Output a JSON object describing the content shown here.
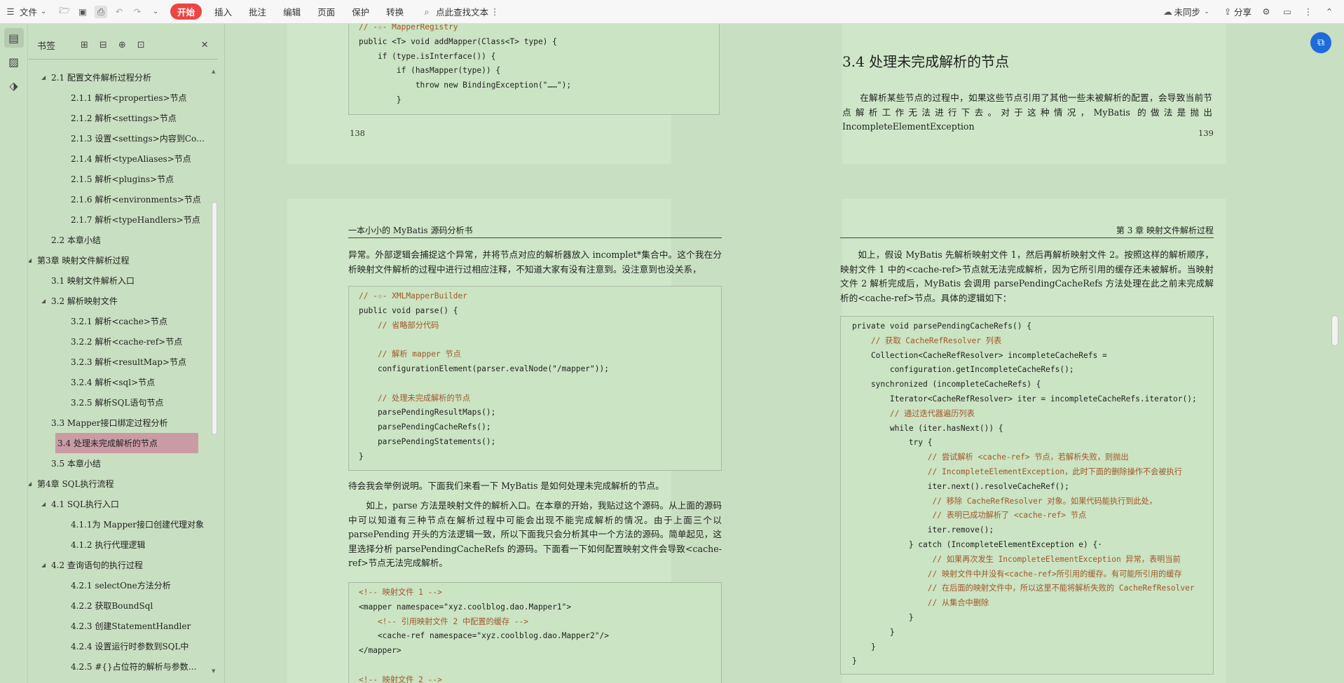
{
  "toolbar": {
    "menu_label": "文件",
    "tabs": [
      "开始",
      "插入",
      "批注",
      "编辑",
      "页面",
      "保护",
      "转换"
    ],
    "search_placeholder": "点此查找文本",
    "sync_label": "未同步",
    "share_label": "分享"
  },
  "panel": {
    "title": "书签",
    "items": [
      {
        "label": "2.1 配置文件解析过程分析",
        "level": 2,
        "expanded": true
      },
      {
        "label": "2.1.1 解析<properties>节点",
        "level": 3
      },
      {
        "label": "2.1.2 解析<settings>节点",
        "level": 3
      },
      {
        "label": "2.1.3 设置<settings>内容到Co…",
        "level": 3
      },
      {
        "label": "2.1.4 解析<typeAliases>节点",
        "level": 3
      },
      {
        "label": "2.1.5 解析<plugins>节点",
        "level": 3
      },
      {
        "label": "2.1.6 解析<environments>节点",
        "level": 3
      },
      {
        "label": "2.1.7 解析<typeHandlers>节点",
        "level": 3
      },
      {
        "label": "2.2 本章小结",
        "level": 2
      },
      {
        "label": "第3章 映射文件解析过程",
        "level": 1,
        "expanded": true
      },
      {
        "label": "3.1 映射文件解析入口",
        "level": 2
      },
      {
        "label": "3.2 解析映射文件",
        "level": 2,
        "expanded": true
      },
      {
        "label": "3.2.1 解析<cache>节点",
        "level": 3
      },
      {
        "label": "3.2.2 解析<cache-ref>节点",
        "level": 3
      },
      {
        "label": "3.2.3 解析<resultMap>节点",
        "level": 3
      },
      {
        "label": "3.2.4 解析<sql>节点",
        "level": 3
      },
      {
        "label": "3.2.5 解析SQL语句节点",
        "level": 3
      },
      {
        "label": "3.3 Mapper接口绑定过程分析",
        "level": 2
      },
      {
        "label": "3.4 处理未完成解析的节点",
        "level": 2,
        "selected": true
      },
      {
        "label": "3.5 本章小结",
        "level": 2
      },
      {
        "label": "第4章 SQL执行流程",
        "level": 1,
        "expanded": true
      },
      {
        "label": "4.1 SQL执行入口",
        "level": 2,
        "expanded": true
      },
      {
        "label": "4.1.1为 Mapper接口创建代理对象",
        "level": 3
      },
      {
        "label": "4.1.2 执行代理逻辑",
        "level": 3
      },
      {
        "label": "4.2 查询语句的执行过程",
        "level": 2,
        "expanded": true
      },
      {
        "label": "4.2.1 selectOne方法分析",
        "level": 3
      },
      {
        "label": "4.2.2 获取BoundSql",
        "level": 3
      },
      {
        "label": "4.2.3 创建StatementHandler",
        "level": 3
      },
      {
        "label": "4.2.4 设置运行时参数到SQL中",
        "level": 3
      },
      {
        "label": "4.2.5 #{}占位符的解析与参数…",
        "level": 3
      }
    ]
  },
  "page138": {
    "code": [
      "// -☆- MapperRegistry",
      "public <T> void addMapper(Class<T> type) {",
      "    if (type.isInterface()) {",
      "        if (hasMapper(type)) {",
      "            throw new BindingException(\"……\");",
      "        }"
    ],
    "page_number": "138"
  },
  "page139": {
    "heading": "3.4 处理未完成解析的节点",
    "paragraph": "在解析某些节点的过程中，如果这些节点引用了其他一些未被解析的配置，会导致当前节点解析工作无法进行下去。对于这种情况，MyBatis 的做法是抛出 IncompleteElementException",
    "page_number": "139"
  },
  "page140": {
    "header": "一本小小的 MyBatis 源码分析书",
    "para1": "异常。外部逻辑会捕捉这个异常，并将节点对应的解析器放入 incomplet*集合中。这个我在分析映射文件解析的过程中进行过相应注释，不知道大家有没有注意到。没注意到也没关系，",
    "code1": [
      "// -☆- XMLMapperBuilder",
      "public void parse() {",
      "    // 省略部分代码",
      "",
      "    // 解析 mapper 节点",
      "    configurationElement(parser.evalNode(\"/mapper\"));",
      "",
      "    // 处理未完成解析的节点",
      "    parsePendingResultMaps();",
      "    parsePendingCacheRefs();",
      "    parsePendingStatements();",
      "}"
    ],
    "para2": "待会我会举例说明。下面我们来看一下 MyBatis 是如何处理未完成解析的节点。",
    "para3": "如上，parse 方法是映射文件的解析入口。在本章的开始，我贴过这个源码。从上面的源码中可以知道有三种节点在解析过程中可能会出现不能完成解析的情况。由于上面三个以 parsePending 开头的方法逻辑一致，所以下面我只会分析其中一个方法的源码。简单起见，这里选择分析 parsePendingCacheRefs 的源码。下面看一下如何配置映射文件会导致<cache-ref>节点无法完成解析。",
    "code2": [
      "<!-- 映射文件 1 -->",
      "<mapper namespace=\"xyz.coolblog.dao.Mapper1\">",
      "    <!-- 引用映射文件 2 中配置的缓存 -->",
      "    <cache-ref namespace=\"xyz.coolblog.dao.Mapper2\"/>",
      "</mapper>",
      "",
      "<!-- 映射文件 2 -->"
    ]
  },
  "page141": {
    "header": "第 3 章 映射文件解析过程",
    "para1": "如上，假设 MyBatis 先解析映射文件 1，然后再解析映射文件 2。按照这样的解析顺序，映射文件 1 中的<cache-ref>节点就无法完成解析，因为它所引用的缓存还未被解析。当映射文件 2 解析完成后，MyBatis 会调用 parsePendingCacheRefs 方法处理在此之前未完成解析的<cache-ref>节点。具体的逻辑如下：",
    "code": [
      "private void parsePendingCacheRefs() {",
      "    // 获取 CacheRefResolver 列表",
      "    Collection<CacheRefResolver> incompleteCacheRefs =",
      "        configuration.getIncompleteCacheRefs();",
      "    synchronized (incompleteCacheRefs) {",
      "        Iterator<CacheRefResolver> iter = incompleteCacheRefs.iterator();",
      "        // 通过迭代器遍历列表",
      "        while (iter.hasNext()) {",
      "            try {",
      "                // 尝试解析 <cache-ref> 节点，若解析失败，则抛出",
      "                // IncompleteElementException，此时下面的删除操作不会被执行",
      "                iter.next().resolveCacheRef();",
      "                 // 移除 CacheRefResolver 对象。如果代码能执行到此处，",
      "                 // 表明已成功解析了 <cache-ref> 节点",
      "                iter.remove();",
      "            } catch (IncompleteElementException e) {·",
      "                 // 如果再次发生 IncompleteElementException 异常，表明当前",
      "                // 映射文件中并没有<cache-ref>所引用的缓存。有可能所引用的缓存",
      "                // 在后面的映射文件中，所以这里不能将解析失败的 CacheRefResolver",
      "                // 从集合中删除",
      "            }",
      "        }",
      "    }",
      "}"
    ]
  }
}
